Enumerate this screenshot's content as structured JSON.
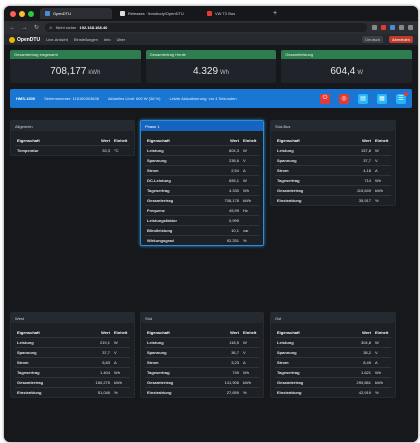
{
  "browser": {
    "tabs": [
      {
        "label": "OpenDTU",
        "active": true
      },
      {
        "label": "Releases · tbnobody/OpenDTU",
        "active": false
      },
      {
        "label": "VW T2 Bus",
        "active": false
      }
    ],
    "new_tab": "+",
    "url_prefix": "Nicht sicher",
    "url_host": "192.168.168.40",
    "nav_back": "←",
    "nav_forward": "→",
    "nav_reload": "↻"
  },
  "app_nav": {
    "brand": "OpenDTU",
    "items": [
      "Live-Ansicht",
      "Einstellungen",
      "Info",
      "Über"
    ],
    "language": "Deutsch",
    "logout": "Abmelden"
  },
  "stats": [
    {
      "label": "Gesamtertrag insgesamt",
      "value": "708,177",
      "unit": "kWh"
    },
    {
      "label": "Gesamtertrag Heute",
      "value": "4.329",
      "unit": "Wh"
    },
    {
      "label": "Gesamtleistung",
      "value": "604,4",
      "unit": "W"
    }
  ],
  "inverter": {
    "name": "HMS-1600",
    "serial": "Seriennummer: 116190303636",
    "limit": "Aktuelles Limit: 600 W (38 %)",
    "update": "Letzte Aktualisierung: vor 4 Sekunden"
  },
  "table_headers": {
    "property": "Eigenschaft",
    "value": "Wert",
    "unit": "Einheit"
  },
  "cards": [
    {
      "title": "Allgemein",
      "rows": [
        {
          "p": "Temperatur",
          "v": "33,3",
          "u": "°C"
        }
      ]
    },
    {
      "title": "Phase 1",
      "rows": [
        {
          "p": "Leistung",
          "v": "604,3",
          "u": "W"
        },
        {
          "p": "Spannung",
          "v": "238,6",
          "u": "V"
        },
        {
          "p": "Strom",
          "v": "2,54",
          "u": "A"
        },
        {
          "p": "DC-Leistung",
          "v": "655,1",
          "u": "W"
        },
        {
          "p": "Tagesertrag",
          "v": "4.330",
          "u": "Wh"
        },
        {
          "p": "Gesamtertrag",
          "v": "708,178",
          "u": "kWh"
        },
        {
          "p": "Frequenz",
          "v": "49,99",
          "u": "Hz"
        },
        {
          "p": "Leistungsfaktor",
          "v": "0,999",
          "u": ""
        },
        {
          "p": "Blindleistung",
          "v": "10,1",
          "u": "var"
        },
        {
          "p": "Wirkungsgrad",
          "v": "92,251",
          "u": "%"
        }
      ]
    },
    {
      "title": "Süd-Bus",
      "rows": [
        {
          "p": "Leistung",
          "v": "157,8",
          "u": "W"
        },
        {
          "p": "Spannung",
          "v": "37,7",
          "u": "V"
        },
        {
          "p": "Strom",
          "v": "4,18",
          "u": "A"
        },
        {
          "p": "Tagesertrag",
          "v": "714",
          "u": "Wh"
        },
        {
          "p": "Gesamtertrag",
          "v": "115,649",
          "u": "kWh"
        },
        {
          "p": "Einstrahlung",
          "v": "35,917",
          "u": "%"
        }
      ]
    },
    {
      "title": "West",
      "rows": [
        {
          "p": "Leistung",
          "v": "219,1",
          "u": "W"
        },
        {
          "p": "Spannung",
          "v": "37,7",
          "u": "V"
        },
        {
          "p": "Strom",
          "v": "5,83",
          "u": "A"
        },
        {
          "p": "Tagesertrag",
          "v": "1.404",
          "u": "Wh"
        },
        {
          "p": "Gesamtertrag",
          "v": "160,275",
          "u": "kWh"
        },
        {
          "p": "Einstrahlung",
          "v": "51,046",
          "u": "%"
        }
      ]
    },
    {
      "title": "Süd",
      "rows": [
        {
          "p": "Leistung",
          "v": "118,5",
          "u": "W"
        },
        {
          "p": "Spannung",
          "v": "36,7",
          "u": "V"
        },
        {
          "p": "Strom",
          "v": "3,23",
          "u": "A"
        },
        {
          "p": "Tagesertrag",
          "v": "749",
          "u": "Wh"
        },
        {
          "p": "Gesamtertrag",
          "v": "141,906",
          "u": "kWh"
        },
        {
          "p": "Einstrahlung",
          "v": "27,659",
          "u": "%"
        }
      ]
    },
    {
      "title": "Ost",
      "rows": [
        {
          "p": "Leistung",
          "v": "304,8",
          "u": "W"
        },
        {
          "p": "Spannung",
          "v": "38,2",
          "u": "V"
        },
        {
          "p": "Strom",
          "v": "8,49",
          "u": "A"
        },
        {
          "p": "Tagesertrag",
          "v": "1.621",
          "u": "Wh"
        },
        {
          "p": "Gesamtertrag",
          "v": "290,861",
          "u": "kWh"
        },
        {
          "p": "Einstrahlung",
          "v": "42,919",
          "u": "%"
        }
      ]
    }
  ],
  "colors": {
    "accent": "#1976d2",
    "stat_header": "#2e7d4f",
    "danger": "#e53935",
    "info": "#29b6f6"
  },
  "icons": [
    "power-icon",
    "limit-icon",
    "info-icon",
    "devinfo-icon",
    "events-icon"
  ]
}
